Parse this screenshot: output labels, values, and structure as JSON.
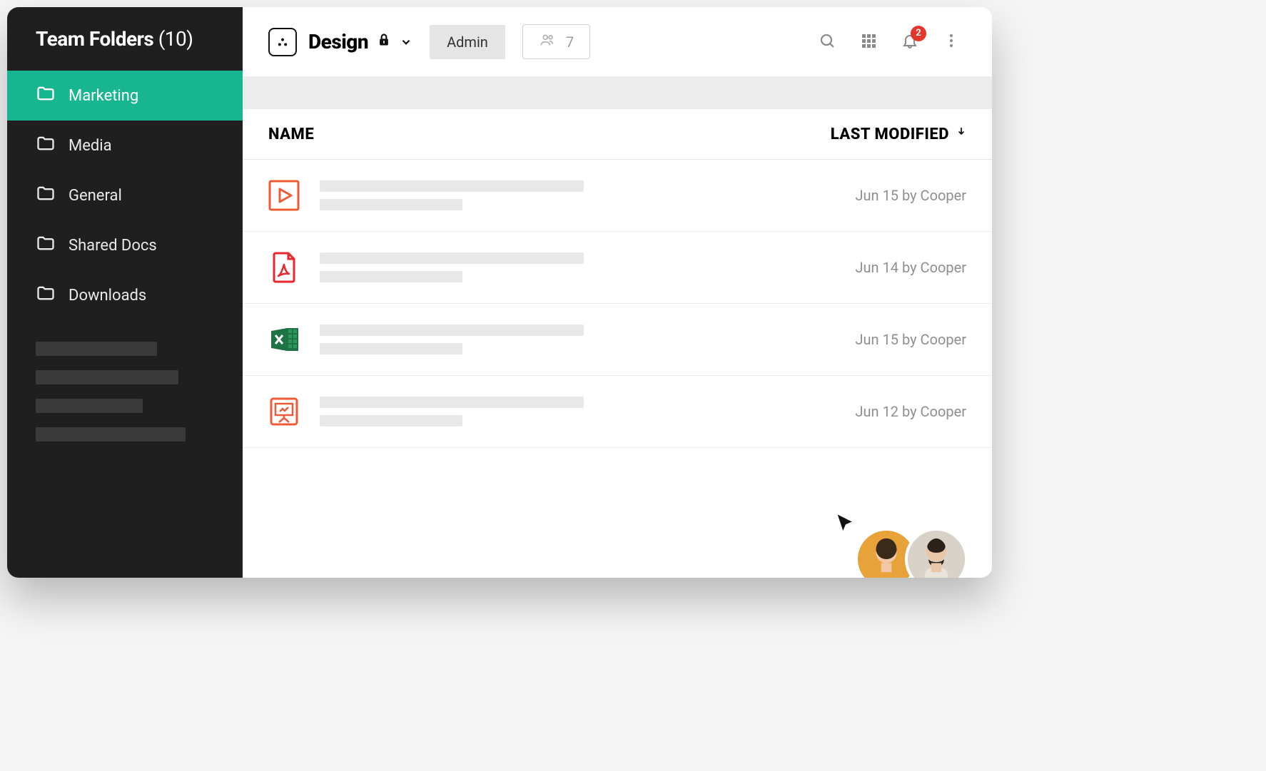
{
  "sidebar": {
    "title_text": "Team Folders",
    "title_count": "(10)",
    "items": [
      {
        "label": "Marketing",
        "active": true
      },
      {
        "label": "Media",
        "active": false
      },
      {
        "label": "General",
        "active": false
      },
      {
        "label": "Shared Docs",
        "active": false
      },
      {
        "label": "Downloads",
        "active": false
      }
    ]
  },
  "header": {
    "breadcrumb_title": "Design",
    "role_label": "Admin",
    "people_count": "7",
    "notification_count": "2"
  },
  "columns": {
    "name_label": "NAME",
    "modified_label": "LAST MODIFIED"
  },
  "files": [
    {
      "type": "video",
      "modified": "Jun 15 by Cooper"
    },
    {
      "type": "pdf",
      "modified": "Jun 14 by Cooper"
    },
    {
      "type": "excel",
      "modified": "Jun 15 by Cooper"
    },
    {
      "type": "presentation",
      "modified": "Jun 12 by Cooper"
    }
  ],
  "icons": {
    "folder": "folder-icon",
    "lock": "lock-icon",
    "chevron": "chevron-down-icon",
    "people": "people-icon",
    "search": "search-icon",
    "grid": "grid-icon",
    "bell": "bell-icon",
    "more": "more-vertical-icon",
    "sort": "sort-down-icon"
  },
  "colors": {
    "accent": "#17b690",
    "sidebar_bg": "#1f1f1f",
    "badge": "#e6352b",
    "video_icon": "#ef5b36",
    "pdf_icon": "#e8262d",
    "excel_icon": "#1e7244",
    "ppt_icon": "#ef5b36"
  }
}
